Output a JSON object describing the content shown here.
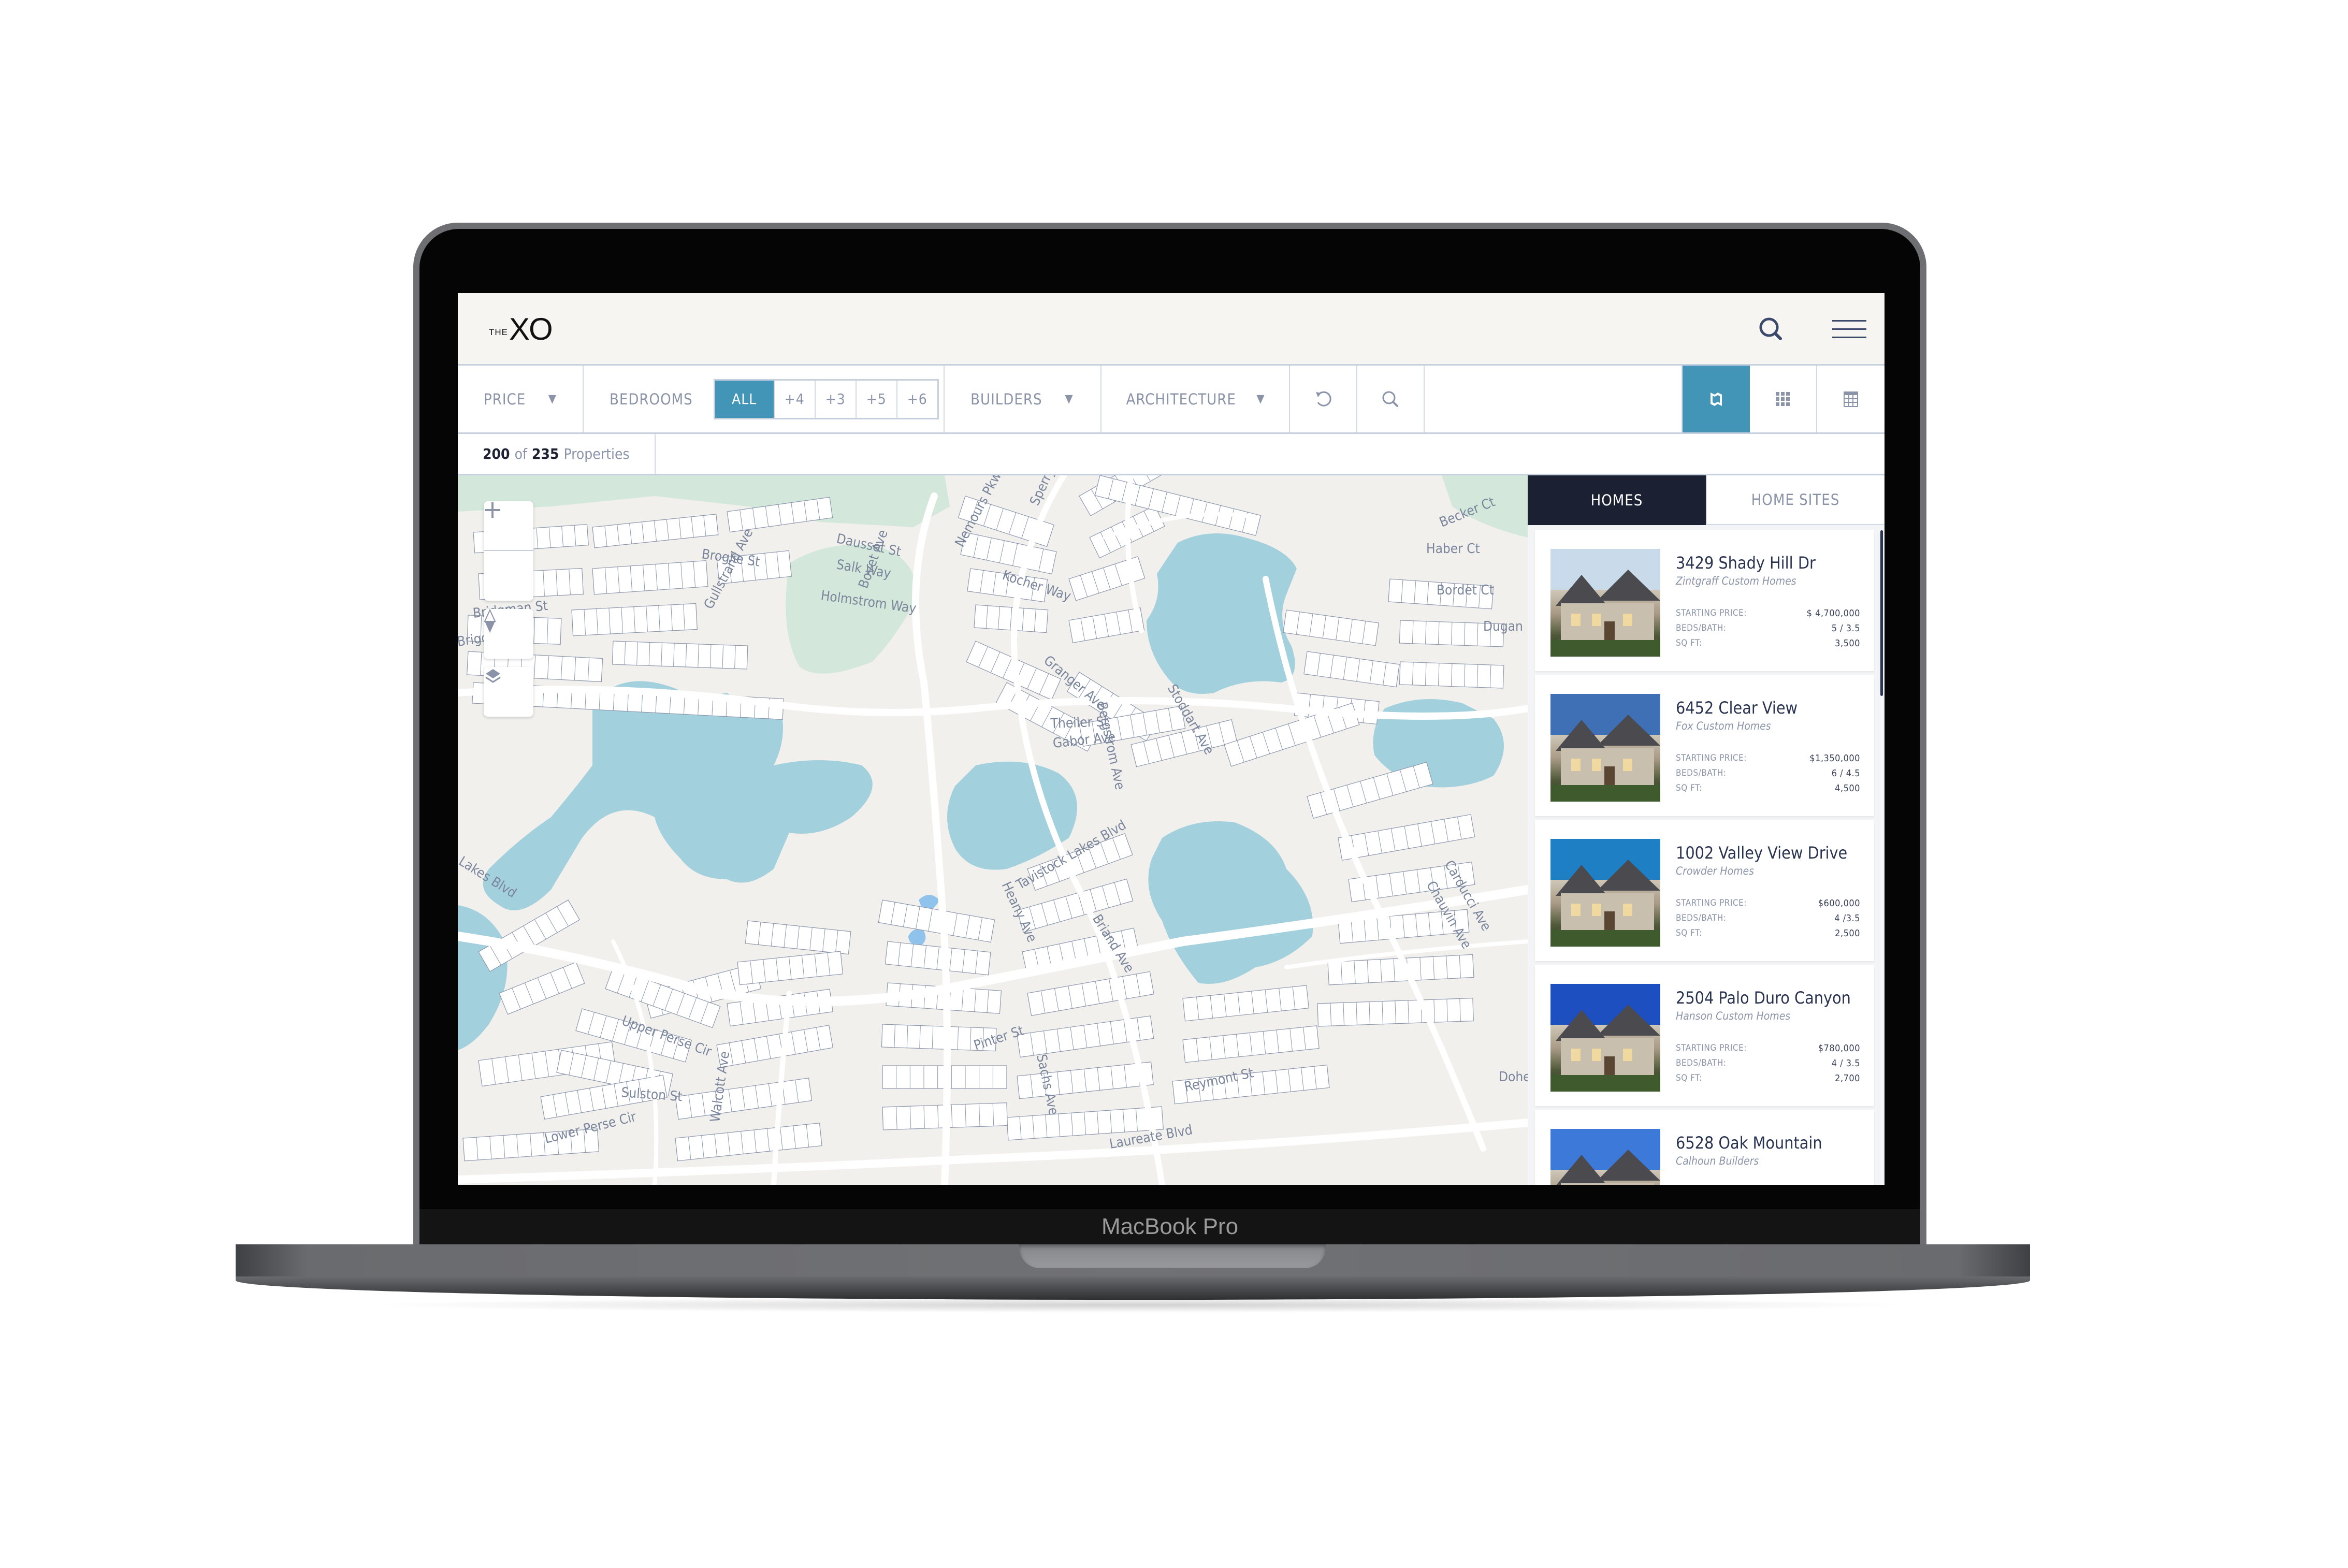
{
  "device": {
    "label": "MacBook Pro"
  },
  "header": {
    "logo_small": "THE",
    "logo_large": "XO",
    "search_icon": "search-icon",
    "menu_icon": "hamburger-menu-icon"
  },
  "filters": {
    "price_label": "PRICE",
    "bedrooms_label": "BEDROOMS",
    "bedroom_options": [
      "ALL",
      "+4",
      "+3",
      "+5",
      "+6"
    ],
    "bedroom_selected": "ALL",
    "builders_label": "BUILDERS",
    "architecture_label": "ARCHITECTURE",
    "reset_icon": "reset-icon",
    "search_icon": "search-icon",
    "views": [
      {
        "name": "map-view",
        "icon": "map-icon",
        "active": true
      },
      {
        "name": "grid-view",
        "icon": "grid-icon",
        "active": false
      },
      {
        "name": "table-view",
        "icon": "table-icon",
        "active": false
      }
    ]
  },
  "results": {
    "shown": "200",
    "of_label": "of",
    "total": "235",
    "unit_label": "Properties"
  },
  "map": {
    "controls": [
      "zoom-in",
      "zoom-out",
      "compass",
      "layers"
    ],
    "colors": {
      "water": "#a3d0dd",
      "park": "#d3e8da",
      "land": "#f1f0ed",
      "lot": "#ffffff",
      "lot_outline": "#8d97ae",
      "label": "#7b869c"
    },
    "streets": [
      "Broglie St",
      "Gullstrand Ave",
      "Bridgman St",
      "Briggs Ave",
      "Dausset St",
      "Salk Way",
      "Holmstrom Way",
      "Bovet Ave",
      "Nemours Pkwy",
      "Sperry St",
      "Kocher Way",
      "Granger Ave",
      "Stoddart Ave",
      "Becker Ct",
      "Haber Ct",
      "Bordet Ct",
      "Dugan",
      "Theiler St",
      "Gabor Ave",
      "Bergstrom Ave",
      "Lakes Blvd",
      "Tavistock Lakes Blvd",
      "Heany Ave",
      "Briand Ave",
      "Chauvin Ave",
      "Carducci Ave",
      "Upper Perse Cir",
      "Walcott Ave",
      "Sachs Ave",
      "Pinter St",
      "Sulston St",
      "Reymont St",
      "Lower Perse Cir",
      "Laureate Blvd",
      "Doherty"
    ]
  },
  "panel": {
    "tabs": [
      {
        "label": "HOMES",
        "active": true
      },
      {
        "label": "HOME SITES",
        "active": false
      }
    ],
    "field_labels": {
      "price": "STARTING PRICE:",
      "beds": "BEDS/BATH:",
      "sqft": "SQ FT:"
    },
    "listings": [
      {
        "title": "3429 Shady Hill Dr",
        "builder": "Zintgraff Custom Homes",
        "price": "$ 4,700,000",
        "beds_bath": "5 / 3.5",
        "sqft": "3,500",
        "sky": "#c9daea"
      },
      {
        "title": "6452 Clear View",
        "builder": "Fox Custom Homes",
        "price": "$1,350,000",
        "beds_bath": "6 / 4.5",
        "sqft": "4,500",
        "sky": "#3f6fb5"
      },
      {
        "title": "1002 Valley View Drive",
        "builder": "Crowder Homes",
        "price": "$600,000",
        "beds_bath": "4 /3.5",
        "sqft": "2,500",
        "sky": "#1f7fc4"
      },
      {
        "title": "2504 Palo Duro Canyon",
        "builder": "Hanson Custom Homes",
        "price": "$780,000",
        "beds_bath": "4 / 3.5",
        "sqft": "2,700",
        "sky": "#1e4fc0"
      },
      {
        "title": "6528 Oak Mountain",
        "builder": "Calhoun Builders",
        "price": "",
        "beds_bath": "",
        "sqft": "",
        "sky": "#3d79d8"
      }
    ]
  }
}
